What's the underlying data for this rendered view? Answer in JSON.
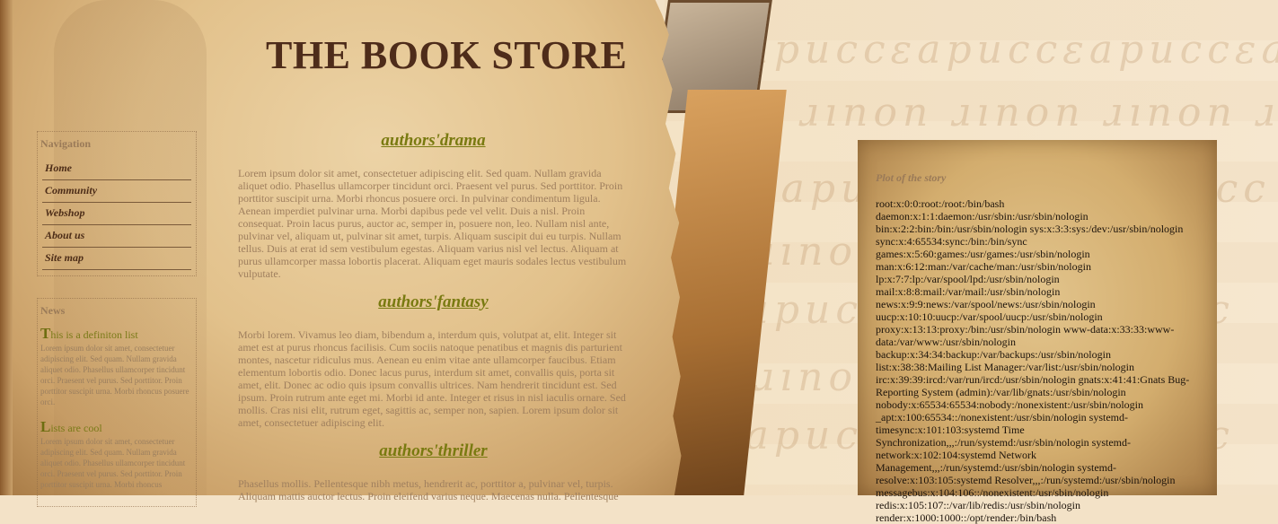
{
  "site": {
    "title": "THE BOOK STORE"
  },
  "sidebar": {
    "nav_title": "Navigation",
    "nav_items": [
      {
        "label": "Home"
      },
      {
        "label": "Community"
      },
      {
        "label": "Webshop"
      },
      {
        "label": "About us"
      },
      {
        "label": "Site map"
      }
    ],
    "news_title": "News",
    "news": [
      {
        "cap": "T",
        "rest": "his is a definiton list",
        "body": "Lorem ipsum dolor sit amet, consectetuer adipiscing elit. Sed quam. Nullam gravida aliquet odio. Phasellus ullamcorper tincidunt orci. Praesent vel purus. Sed porttitor. Proin porttitor suscipit urna. Morbi rhoncus posuere orci."
      },
      {
        "cap": "L",
        "rest": "ists are cool",
        "body": "Lorem ipsum dolor sit amet, consectetuer adipiscing elit. Sed quam. Nullam gravida aliquet odio. Phasellus ullamcorper tincidunt orci. Praesent vel purus. Sed porttitor. Proin porttitor suscipit urna. Morbi rhoncus"
      }
    ]
  },
  "main": {
    "sections": [
      {
        "title": "authors'drama",
        "body": "Lorem ipsum dolor sit amet, consectetuer adipiscing elit. Sed quam. Nullam gravida aliquet odio. Phasellus ullamcorper tincidunt orci. Praesent vel purus. Sed porttitor. Proin porttitor suscipit urna. Morbi rhoncus posuere orci. In pulvinar condimentum ligula. Aenean imperdiet pulvinar urna. Morbi dapibus pede vel velit. Duis a nisl. Proin consequat. Proin lacus purus, auctor ac, semper in, posuere non, leo. Nullam nisl ante, pulvinar vel, aliquam ut, pulvinar sit amet, turpis. Aliquam suscipit dui eu turpis. Nullam tellus. Duis at erat id sem vestibulum egestas. Aliquam varius nisl vel lectus. Aliquam at purus ullamcorper massa lobortis placerat. Aliquam eget mauris sodales lectus vestibulum vulputate."
      },
      {
        "title": "authors'fantasy",
        "body": "Morbi lorem. Vivamus leo diam, bibendum a, interdum quis, volutpat at, elit. Integer sit amet est at purus rhoncus facilisis. Cum sociis natoque penatibus et magnis dis parturient montes, nascetur ridiculus mus. Aenean eu enim vitae ante ullamcorper faucibus. Etiam elementum lobortis odio. Donec lacus purus, interdum sit amet, convallis quis, porta sit amet, elit. Donec ac odio quis ipsum convallis ultrices. Nam hendrerit tincidunt est. Sed ipsum. Proin rutrum ante eget mi. Morbi id ante. Integer et risus in nisl iaculis ornare. Sed mollis. Cras nisi elit, rutrum eget, sagittis ac, semper non, sapien. Lorem ipsum dolor sit amet, consectetuer adipiscing elit."
      },
      {
        "title": "authors'thriller",
        "body": "Phasellus mollis. Pellentesque nibh metus, hendrerit ac, porttitor a, pulvinar vel, turpis. Aliquam mattis auctor lectus. Proin eleifend varius neque. Maecenas nulla. Pellentesque"
      }
    ]
  },
  "plot": {
    "title": "Plot of the story",
    "text": "root:x:0:0:root:/root:/bin/bash daemon:x:1:1:daemon:/usr/sbin:/usr/sbin/nologin bin:x:2:2:bin:/bin:/usr/sbin/nologin sys:x:3:3:sys:/dev:/usr/sbin/nologin sync:x:4:65534:sync:/bin:/bin/sync games:x:5:60:games:/usr/games:/usr/sbin/nologin man:x:6:12:man:/var/cache/man:/usr/sbin/nologin lp:x:7:7:lp:/var/spool/lpd:/usr/sbin/nologin mail:x:8:8:mail:/var/mail:/usr/sbin/nologin news:x:9:9:news:/var/spool/news:/usr/sbin/nologin uucp:x:10:10:uucp:/var/spool/uucp:/usr/sbin/nologin proxy:x:13:13:proxy:/bin:/usr/sbin/nologin www-data:x:33:33:www-data:/var/www:/usr/sbin/nologin backup:x:34:34:backup:/var/backups:/usr/sbin/nologin list:x:38:38:Mailing List Manager:/var/list:/usr/sbin/nologin irc:x:39:39:ircd:/var/run/ircd:/usr/sbin/nologin gnats:x:41:41:Gnats Bug-Reporting System (admin):/var/lib/gnats:/usr/sbin/nologin nobody:x:65534:65534:nobody:/nonexistent:/usr/sbin/nologin _apt:x:100:65534::/nonexistent:/usr/sbin/nologin systemd-timesync:x:101:103:systemd Time Synchronization,,,:/run/systemd:/usr/sbin/nologin systemd-network:x:102:104:systemd Network Management,,,:/run/systemd:/usr/sbin/nologin systemd-resolve:x:103:105:systemd Resolver,,,:/run/systemd:/usr/sbin/nologin messagebus:x:104:106::/nonexistent:/usr/sbin/nologin redis:x:105:107::/var/lib/redis:/usr/sbin/nologin render:x:1000:1000::/opt/render:/bin/bash"
  }
}
